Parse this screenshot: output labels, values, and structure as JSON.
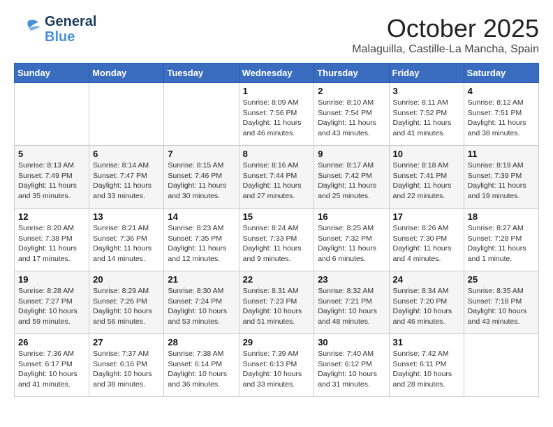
{
  "logo": {
    "line1": "General",
    "line2": "Blue"
  },
  "header": {
    "month": "October 2025",
    "location": "Malaguilla, Castille-La Mancha, Spain"
  },
  "weekdays": [
    "Sunday",
    "Monday",
    "Tuesday",
    "Wednesday",
    "Thursday",
    "Friday",
    "Saturday"
  ],
  "weeks": [
    [
      {
        "day": "",
        "info": ""
      },
      {
        "day": "",
        "info": ""
      },
      {
        "day": "",
        "info": ""
      },
      {
        "day": "1",
        "info": "Sunrise: 8:09 AM\nSunset: 7:56 PM\nDaylight: 11 hours\nand 46 minutes."
      },
      {
        "day": "2",
        "info": "Sunrise: 8:10 AM\nSunset: 7:54 PM\nDaylight: 11 hours\nand 43 minutes."
      },
      {
        "day": "3",
        "info": "Sunrise: 8:11 AM\nSunset: 7:52 PM\nDaylight: 11 hours\nand 41 minutes."
      },
      {
        "day": "4",
        "info": "Sunrise: 8:12 AM\nSunset: 7:51 PM\nDaylight: 11 hours\nand 38 minutes."
      }
    ],
    [
      {
        "day": "5",
        "info": "Sunrise: 8:13 AM\nSunset: 7:49 PM\nDaylight: 11 hours\nand 35 minutes."
      },
      {
        "day": "6",
        "info": "Sunrise: 8:14 AM\nSunset: 7:47 PM\nDaylight: 11 hours\nand 33 minutes."
      },
      {
        "day": "7",
        "info": "Sunrise: 8:15 AM\nSunset: 7:46 PM\nDaylight: 11 hours\nand 30 minutes."
      },
      {
        "day": "8",
        "info": "Sunrise: 8:16 AM\nSunset: 7:44 PM\nDaylight: 11 hours\nand 27 minutes."
      },
      {
        "day": "9",
        "info": "Sunrise: 8:17 AM\nSunset: 7:42 PM\nDaylight: 11 hours\nand 25 minutes."
      },
      {
        "day": "10",
        "info": "Sunrise: 8:18 AM\nSunset: 7:41 PM\nDaylight: 11 hours\nand 22 minutes."
      },
      {
        "day": "11",
        "info": "Sunrise: 8:19 AM\nSunset: 7:39 PM\nDaylight: 11 hours\nand 19 minutes."
      }
    ],
    [
      {
        "day": "12",
        "info": "Sunrise: 8:20 AM\nSunset: 7:38 PM\nDaylight: 11 hours\nand 17 minutes."
      },
      {
        "day": "13",
        "info": "Sunrise: 8:21 AM\nSunset: 7:36 PM\nDaylight: 11 hours\nand 14 minutes."
      },
      {
        "day": "14",
        "info": "Sunrise: 8:23 AM\nSunset: 7:35 PM\nDaylight: 11 hours\nand 12 minutes."
      },
      {
        "day": "15",
        "info": "Sunrise: 8:24 AM\nSunset: 7:33 PM\nDaylight: 11 hours\nand 9 minutes."
      },
      {
        "day": "16",
        "info": "Sunrise: 8:25 AM\nSunset: 7:32 PM\nDaylight: 11 hours\nand 6 minutes."
      },
      {
        "day": "17",
        "info": "Sunrise: 8:26 AM\nSunset: 7:30 PM\nDaylight: 11 hours\nand 4 minutes."
      },
      {
        "day": "18",
        "info": "Sunrise: 8:27 AM\nSunset: 7:28 PM\nDaylight: 11 hours\nand 1 minute."
      }
    ],
    [
      {
        "day": "19",
        "info": "Sunrise: 8:28 AM\nSunset: 7:27 PM\nDaylight: 10 hours\nand 59 minutes."
      },
      {
        "day": "20",
        "info": "Sunrise: 8:29 AM\nSunset: 7:26 PM\nDaylight: 10 hours\nand 56 minutes."
      },
      {
        "day": "21",
        "info": "Sunrise: 8:30 AM\nSunset: 7:24 PM\nDaylight: 10 hours\nand 53 minutes."
      },
      {
        "day": "22",
        "info": "Sunrise: 8:31 AM\nSunset: 7:23 PM\nDaylight: 10 hours\nand 51 minutes."
      },
      {
        "day": "23",
        "info": "Sunrise: 8:32 AM\nSunset: 7:21 PM\nDaylight: 10 hours\nand 48 minutes."
      },
      {
        "day": "24",
        "info": "Sunrise: 8:34 AM\nSunset: 7:20 PM\nDaylight: 10 hours\nand 46 minutes."
      },
      {
        "day": "25",
        "info": "Sunrise: 8:35 AM\nSunset: 7:18 PM\nDaylight: 10 hours\nand 43 minutes."
      }
    ],
    [
      {
        "day": "26",
        "info": "Sunrise: 7:36 AM\nSunset: 6:17 PM\nDaylight: 10 hours\nand 41 minutes."
      },
      {
        "day": "27",
        "info": "Sunrise: 7:37 AM\nSunset: 6:16 PM\nDaylight: 10 hours\nand 38 minutes."
      },
      {
        "day": "28",
        "info": "Sunrise: 7:38 AM\nSunset: 6:14 PM\nDaylight: 10 hours\nand 36 minutes."
      },
      {
        "day": "29",
        "info": "Sunrise: 7:39 AM\nSunset: 6:13 PM\nDaylight: 10 hours\nand 33 minutes."
      },
      {
        "day": "30",
        "info": "Sunrise: 7:40 AM\nSunset: 6:12 PM\nDaylight: 10 hours\nand 31 minutes."
      },
      {
        "day": "31",
        "info": "Sunrise: 7:42 AM\nSunset: 6:11 PM\nDaylight: 10 hours\nand 28 minutes."
      },
      {
        "day": "",
        "info": ""
      }
    ]
  ]
}
